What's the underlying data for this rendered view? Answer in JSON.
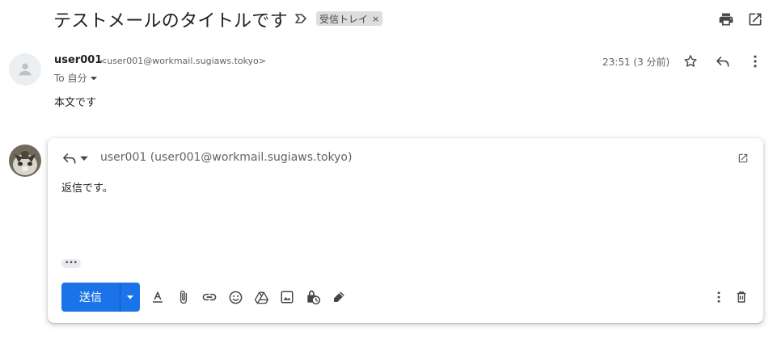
{
  "header": {
    "subject": "テストメールのタイトルです",
    "label_chip": "受信トレイ",
    "label_remove": "×"
  },
  "message": {
    "sender_name": "user001",
    "sender_email": "<user001@workmail.sugiaws.tokyo>",
    "to_line": "To 自分",
    "timestamp": "23:51 (3 分前)",
    "body": "本文です"
  },
  "reply": {
    "recipient": "user001 (user001@workmail.sugiaws.tokyo)",
    "body": "返信です。",
    "trimmed_content": "•••",
    "send_label": "送信"
  },
  "icons": {
    "header": [
      "label-arrow-icon",
      "print-icon",
      "open-in-new-window-icon"
    ],
    "message": [
      "default-avatar-icon",
      "chevron-down-icon",
      "star-icon",
      "reply-icon",
      "more-vert-icon"
    ],
    "reply": [
      "reply-icon",
      "arrow-drop-down-icon",
      "popout-icon"
    ],
    "toolbar": [
      "formatting-icon",
      "attach-icon",
      "link-icon",
      "emoji-icon",
      "drive-icon",
      "photo-icon",
      "confidential-icon",
      "signature-icon",
      "more-options-icon",
      "delete-icon"
    ]
  },
  "colors": {
    "primary": "#1a73e8",
    "text": "#202124",
    "secondary_text": "#5f6368",
    "icon": "#444746",
    "chip_bg": "#dddddd"
  }
}
